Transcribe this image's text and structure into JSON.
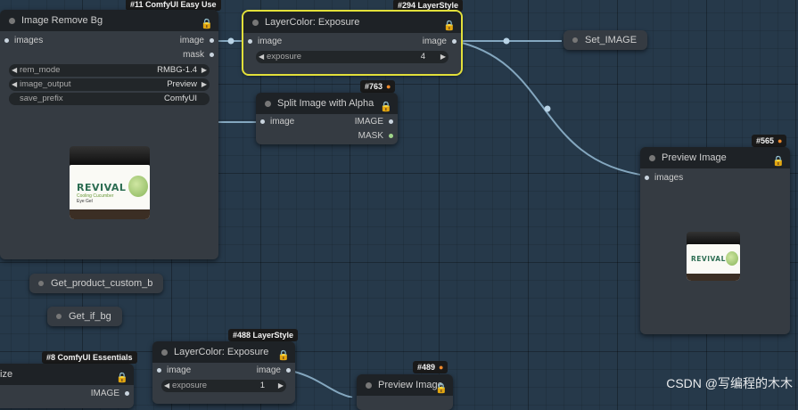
{
  "nodes": {
    "image_remove_bg": {
      "badge": "#11 ComfyUI Easy Use",
      "title": "Image Remove Bg",
      "inputs": [
        "images"
      ],
      "outputs": [
        "image",
        "mask"
      ],
      "widgets": [
        {
          "label": "rem_mode",
          "value": "RMBG-1.4"
        },
        {
          "label": "image_output",
          "value": "Preview"
        },
        {
          "label": "save_prefix",
          "value": "ComfyUI"
        }
      ]
    },
    "layercolor_exposure_294": {
      "badge": "#294 LayerStyle",
      "title": "LayerColor: Exposure",
      "input": "image",
      "output": "image",
      "widget": {
        "label": "exposure",
        "value": "4"
      }
    },
    "set_image": {
      "title": "Set_IMAGE"
    },
    "split_image_alpha": {
      "badge": "#763",
      "title": "Split Image with Alpha",
      "input": "image",
      "outputs": [
        "IMAGE",
        "MASK"
      ]
    },
    "preview_image_565": {
      "badge": "#565",
      "title": "Preview Image",
      "input": "images"
    },
    "get_product_custom": {
      "title": "Get_product_custom_b"
    },
    "get_if_bg": {
      "title": "Get_if_bg"
    },
    "essentials_8": {
      "badge": "#8 ComfyUI Essentials",
      "title": "ize",
      "output": "IMAGE"
    },
    "layercolor_exposure_488": {
      "badge": "#488 LayerStyle",
      "title": "LayerColor: Exposure",
      "input": "image",
      "output": "image",
      "widget": {
        "label": "exposure",
        "value": "1"
      }
    },
    "preview_image_489": {
      "badge": "#489",
      "title": "Preview Image"
    }
  },
  "product": {
    "brand": "REVIVAL",
    "line1": "Cooling Cucumber",
    "line2": "Eye Gel"
  },
  "watermark": "CSDN @写编程的木木",
  "icons": [
    "lock-icon",
    "fox-icon",
    "arrow-left-icon",
    "arrow-right-icon"
  ],
  "colors": {
    "selection": "#e2e03a",
    "wire": "#8fb4cc",
    "canvas": "#26394a"
  }
}
